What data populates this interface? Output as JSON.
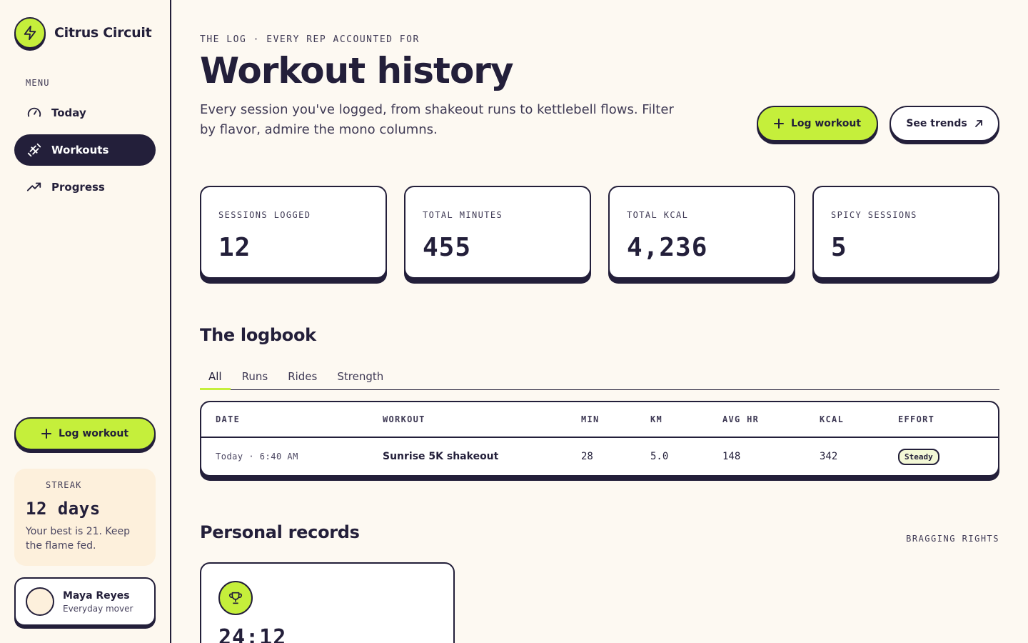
{
  "app": {
    "name": "Citrus Circuit"
  },
  "sidebar": {
    "menu_label": "MENU",
    "items": [
      {
        "label": "Today",
        "icon": "gauge-icon",
        "active": false
      },
      {
        "label": "Workouts",
        "icon": "dumbbell-icon",
        "active": true
      },
      {
        "label": "Progress",
        "icon": "trend-up-icon",
        "active": false
      }
    ],
    "cta_label": "Log workout",
    "streak": {
      "label": "STREAK",
      "value": "12 days",
      "note": "Your best is 21. Keep the flame fed."
    },
    "profile": {
      "name": "Maya Reyes",
      "subtitle": "Everyday mover"
    }
  },
  "header": {
    "eyebrow": "THE LOG · EVERY REP ACCOUNTED FOR",
    "title": "Workout history",
    "description": "Every session you've logged, from shakeout runs to kettlebell flows. Filter by flavor, admire the mono columns.",
    "primary_button": "Log workout",
    "secondary_button": "See trends"
  },
  "stats": [
    {
      "label": "SESSIONS LOGGED",
      "value": "12"
    },
    {
      "label": "TOTAL MINUTES",
      "value": "455"
    },
    {
      "label": "TOTAL KCAL",
      "value": "4,236"
    },
    {
      "label": "SPICY SESSIONS",
      "value": "5"
    }
  ],
  "logbook": {
    "title": "The logbook",
    "tabs": [
      {
        "label": "All",
        "active": true
      },
      {
        "label": "Runs",
        "active": false
      },
      {
        "label": "Rides",
        "active": false
      },
      {
        "label": "Strength",
        "active": false
      }
    ],
    "columns": [
      "DATE",
      "WORKOUT",
      "MIN",
      "KM",
      "AVG HR",
      "KCAL",
      "EFFORT"
    ],
    "rows": [
      {
        "date": "Today · 6:40 AM",
        "workout": "Sunrise 5K shakeout",
        "min": "28",
        "km": "5.0",
        "avg_hr": "148",
        "kcal": "342",
        "effort": "Steady"
      }
    ]
  },
  "records": {
    "title": "Personal records",
    "tag": "BRAGGING RIGHTS",
    "items": [
      {
        "icon": "trophy-icon",
        "value": "24:12"
      }
    ]
  },
  "colors": {
    "accent": "#c5ef3b",
    "ink": "#231f3a",
    "background": "#fdf9f2",
    "streak_bg": "#fdf0dc"
  }
}
